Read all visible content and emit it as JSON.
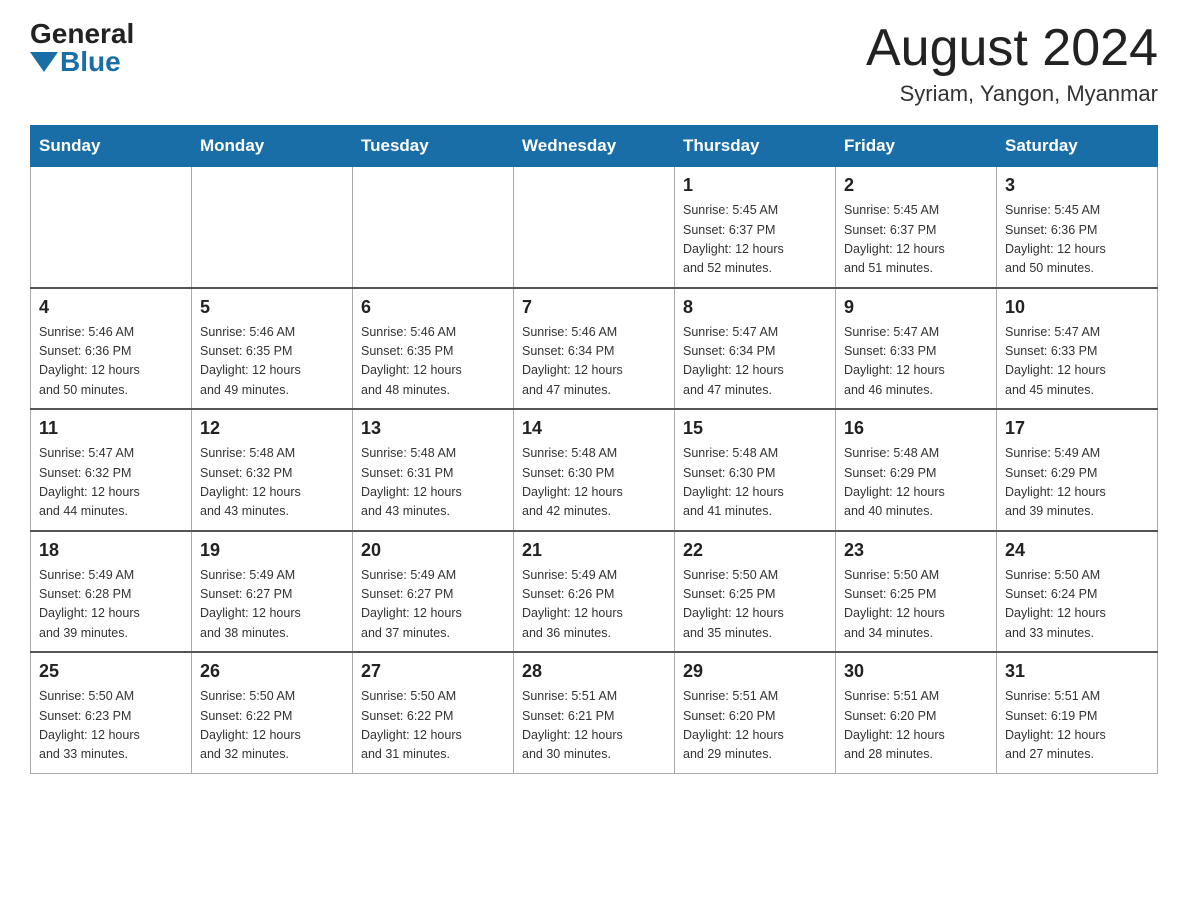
{
  "header": {
    "logo_general": "General",
    "logo_blue": "Blue",
    "title": "August 2024",
    "subtitle": "Syriam, Yangon, Myanmar"
  },
  "weekdays": [
    "Sunday",
    "Monday",
    "Tuesday",
    "Wednesday",
    "Thursday",
    "Friday",
    "Saturday"
  ],
  "weeks": [
    [
      {
        "day": "",
        "info": ""
      },
      {
        "day": "",
        "info": ""
      },
      {
        "day": "",
        "info": ""
      },
      {
        "day": "",
        "info": ""
      },
      {
        "day": "1",
        "info": "Sunrise: 5:45 AM\nSunset: 6:37 PM\nDaylight: 12 hours\nand 52 minutes."
      },
      {
        "day": "2",
        "info": "Sunrise: 5:45 AM\nSunset: 6:37 PM\nDaylight: 12 hours\nand 51 minutes."
      },
      {
        "day": "3",
        "info": "Sunrise: 5:45 AM\nSunset: 6:36 PM\nDaylight: 12 hours\nand 50 minutes."
      }
    ],
    [
      {
        "day": "4",
        "info": "Sunrise: 5:46 AM\nSunset: 6:36 PM\nDaylight: 12 hours\nand 50 minutes."
      },
      {
        "day": "5",
        "info": "Sunrise: 5:46 AM\nSunset: 6:35 PM\nDaylight: 12 hours\nand 49 minutes."
      },
      {
        "day": "6",
        "info": "Sunrise: 5:46 AM\nSunset: 6:35 PM\nDaylight: 12 hours\nand 48 minutes."
      },
      {
        "day": "7",
        "info": "Sunrise: 5:46 AM\nSunset: 6:34 PM\nDaylight: 12 hours\nand 47 minutes."
      },
      {
        "day": "8",
        "info": "Sunrise: 5:47 AM\nSunset: 6:34 PM\nDaylight: 12 hours\nand 47 minutes."
      },
      {
        "day": "9",
        "info": "Sunrise: 5:47 AM\nSunset: 6:33 PM\nDaylight: 12 hours\nand 46 minutes."
      },
      {
        "day": "10",
        "info": "Sunrise: 5:47 AM\nSunset: 6:33 PM\nDaylight: 12 hours\nand 45 minutes."
      }
    ],
    [
      {
        "day": "11",
        "info": "Sunrise: 5:47 AM\nSunset: 6:32 PM\nDaylight: 12 hours\nand 44 minutes."
      },
      {
        "day": "12",
        "info": "Sunrise: 5:48 AM\nSunset: 6:32 PM\nDaylight: 12 hours\nand 43 minutes."
      },
      {
        "day": "13",
        "info": "Sunrise: 5:48 AM\nSunset: 6:31 PM\nDaylight: 12 hours\nand 43 minutes."
      },
      {
        "day": "14",
        "info": "Sunrise: 5:48 AM\nSunset: 6:30 PM\nDaylight: 12 hours\nand 42 minutes."
      },
      {
        "day": "15",
        "info": "Sunrise: 5:48 AM\nSunset: 6:30 PM\nDaylight: 12 hours\nand 41 minutes."
      },
      {
        "day": "16",
        "info": "Sunrise: 5:48 AM\nSunset: 6:29 PM\nDaylight: 12 hours\nand 40 minutes."
      },
      {
        "day": "17",
        "info": "Sunrise: 5:49 AM\nSunset: 6:29 PM\nDaylight: 12 hours\nand 39 minutes."
      }
    ],
    [
      {
        "day": "18",
        "info": "Sunrise: 5:49 AM\nSunset: 6:28 PM\nDaylight: 12 hours\nand 39 minutes."
      },
      {
        "day": "19",
        "info": "Sunrise: 5:49 AM\nSunset: 6:27 PM\nDaylight: 12 hours\nand 38 minutes."
      },
      {
        "day": "20",
        "info": "Sunrise: 5:49 AM\nSunset: 6:27 PM\nDaylight: 12 hours\nand 37 minutes."
      },
      {
        "day": "21",
        "info": "Sunrise: 5:49 AM\nSunset: 6:26 PM\nDaylight: 12 hours\nand 36 minutes."
      },
      {
        "day": "22",
        "info": "Sunrise: 5:50 AM\nSunset: 6:25 PM\nDaylight: 12 hours\nand 35 minutes."
      },
      {
        "day": "23",
        "info": "Sunrise: 5:50 AM\nSunset: 6:25 PM\nDaylight: 12 hours\nand 34 minutes."
      },
      {
        "day": "24",
        "info": "Sunrise: 5:50 AM\nSunset: 6:24 PM\nDaylight: 12 hours\nand 33 minutes."
      }
    ],
    [
      {
        "day": "25",
        "info": "Sunrise: 5:50 AM\nSunset: 6:23 PM\nDaylight: 12 hours\nand 33 minutes."
      },
      {
        "day": "26",
        "info": "Sunrise: 5:50 AM\nSunset: 6:22 PM\nDaylight: 12 hours\nand 32 minutes."
      },
      {
        "day": "27",
        "info": "Sunrise: 5:50 AM\nSunset: 6:22 PM\nDaylight: 12 hours\nand 31 minutes."
      },
      {
        "day": "28",
        "info": "Sunrise: 5:51 AM\nSunset: 6:21 PM\nDaylight: 12 hours\nand 30 minutes."
      },
      {
        "day": "29",
        "info": "Sunrise: 5:51 AM\nSunset: 6:20 PM\nDaylight: 12 hours\nand 29 minutes."
      },
      {
        "day": "30",
        "info": "Sunrise: 5:51 AM\nSunset: 6:20 PM\nDaylight: 12 hours\nand 28 minutes."
      },
      {
        "day": "31",
        "info": "Sunrise: 5:51 AM\nSunset: 6:19 PM\nDaylight: 12 hours\nand 27 minutes."
      }
    ]
  ]
}
